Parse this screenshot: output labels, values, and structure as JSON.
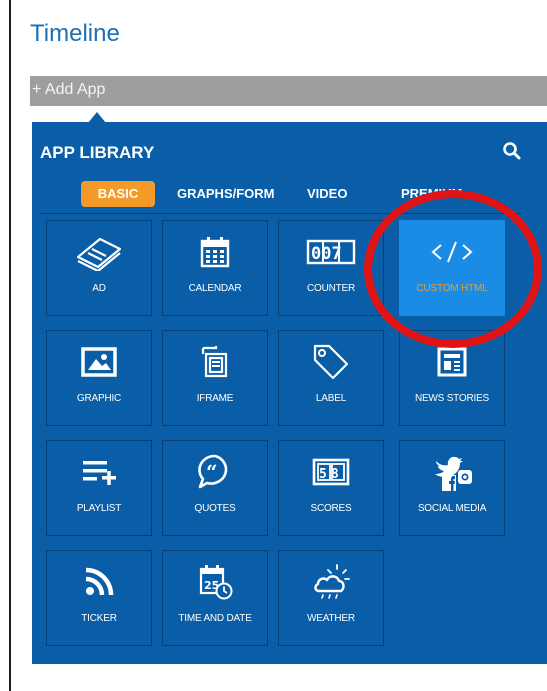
{
  "page": {
    "title": "Timeline"
  },
  "add_app": {
    "label": "+ Add App"
  },
  "library": {
    "title": "APP LIBRARY",
    "tabs": [
      {
        "label": "BASIC",
        "active": true
      },
      {
        "label": "GRAPHS/FORM",
        "active": false
      },
      {
        "label": "VIDEO",
        "active": false
      },
      {
        "label": "PREMIUM",
        "active": false
      }
    ],
    "apps": [
      {
        "label": "AD",
        "icon": "ad-icon"
      },
      {
        "label": "CALENDAR",
        "icon": "calendar-icon"
      },
      {
        "label": "COUNTER",
        "icon": "counter-icon",
        "digits": "007"
      },
      {
        "label": "CUSTOM HTML",
        "icon": "code-icon",
        "selected": true
      },
      {
        "label": "GRAPHIC",
        "icon": "image-icon"
      },
      {
        "label": "IFRAME",
        "icon": "iframe-icon"
      },
      {
        "label": "LABEL",
        "icon": "tag-icon"
      },
      {
        "label": "NEWS STORIES",
        "icon": "newspaper-icon"
      },
      {
        "label": "PLAYLIST",
        "icon": "playlist-icon"
      },
      {
        "label": "QUOTES",
        "icon": "quote-bubble-icon"
      },
      {
        "label": "SCORES",
        "icon": "scoreboard-icon",
        "digits": "58"
      },
      {
        "label": "SOCIAL MEDIA",
        "icon": "social-media-icon"
      },
      {
        "label": "TICKER",
        "icon": "rss-icon"
      },
      {
        "label": "TIME AND DATE",
        "icon": "calendar-clock-icon",
        "digits": "25"
      },
      {
        "label": "WEATHER",
        "icon": "cloud-sun-icon"
      }
    ]
  },
  "colors": {
    "title_blue": "#1f6fb0",
    "library_bg": "#0a5ea8",
    "tile_border": "#053f73",
    "selected_tile": "#1a8ce6",
    "active_tab": "#f39a28",
    "highlight_red": "#e01414",
    "add_bar": "#9e9e9e"
  }
}
